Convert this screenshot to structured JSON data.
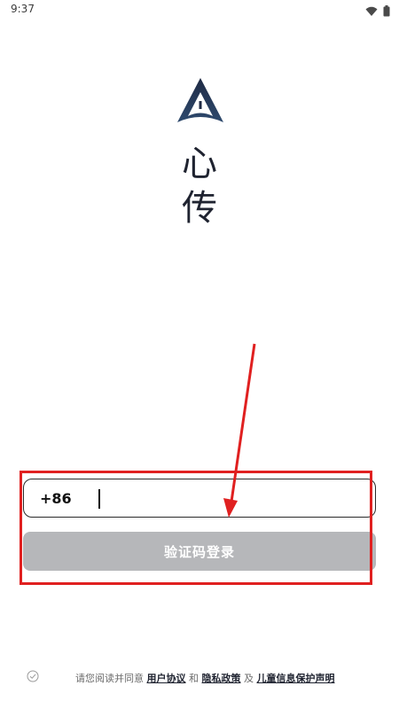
{
  "status_bar": {
    "time": "9:37",
    "icons": [
      "wifi-icon",
      "battery-icon"
    ]
  },
  "brand": {
    "logo_icon": "app-logo-icon",
    "name_line1": "心",
    "name_line2": "传"
  },
  "login_form": {
    "country_code": "+86",
    "phone_value": "",
    "phone_placeholder": "",
    "login_button_label": "验证码登录"
  },
  "annotation": {
    "box_color": "#e02020",
    "arrow_color": "#e02020"
  },
  "agreement": {
    "prefix": "请您阅读并同意 ",
    "user_agreement": "用户协议",
    "and": " 和 ",
    "privacy_policy": "隐私政策",
    "also": " 及 ",
    "child_privacy": "儿童信息保护声明",
    "checked": false
  },
  "colors": {
    "button_disabled": "#b6b7ba",
    "brand_dark": "#1f2330"
  }
}
